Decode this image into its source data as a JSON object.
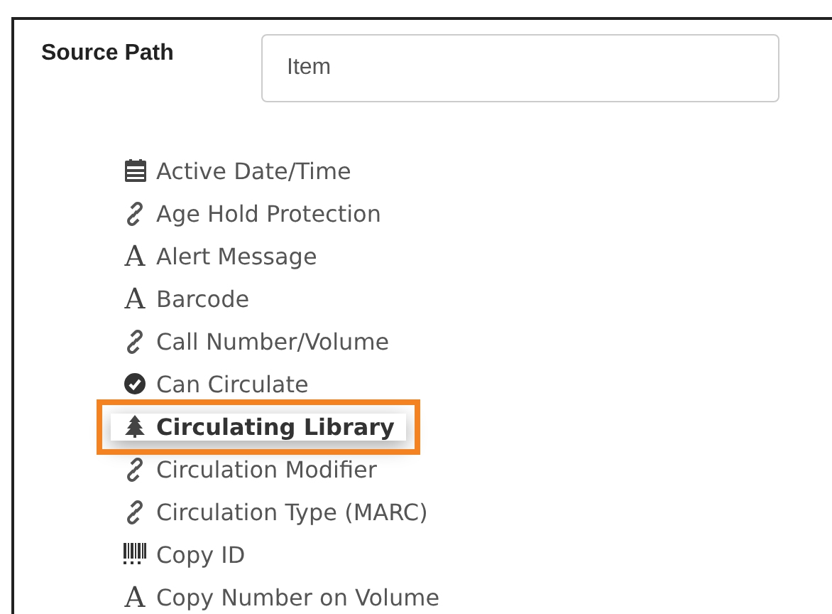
{
  "source_path": {
    "label": "Source Path",
    "value": "Item"
  },
  "fields": [
    {
      "label": "Active Date/Time",
      "kind": "date",
      "selected": false
    },
    {
      "label": "Age Hold Protection",
      "kind": "link",
      "selected": false
    },
    {
      "label": "Alert Message",
      "kind": "text",
      "icon": "A",
      "selected": false
    },
    {
      "label": "Barcode",
      "kind": "text",
      "icon": "A",
      "selected": false
    },
    {
      "label": "Call Number/Volume",
      "kind": "link",
      "selected": false
    },
    {
      "label": "Can Circulate",
      "kind": "bool",
      "selected": false
    },
    {
      "label": "Circulating Library",
      "kind": "org",
      "selected": true
    },
    {
      "label": "Circulation Modifier",
      "kind": "link",
      "selected": false
    },
    {
      "label": "Circulation Type (MARC)",
      "kind": "link",
      "selected": false
    },
    {
      "label": "Copy ID",
      "kind": "id",
      "selected": false
    },
    {
      "label": "Copy Number on Volume",
      "kind": "text",
      "icon": "A",
      "selected": false
    }
  ]
}
